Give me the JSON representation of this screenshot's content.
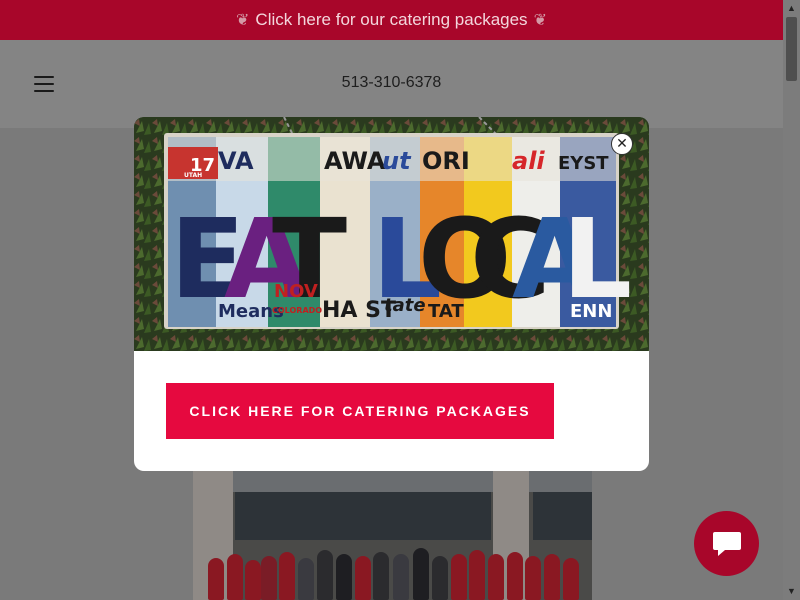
{
  "announcement": {
    "text": "Click here for our catering packages",
    "leaf_icon": "leaf-icon"
  },
  "header": {
    "phone": "513-310-6378",
    "menu_icon": "hamburger-menu-icon"
  },
  "modal": {
    "image": {
      "alt_semantic": "eat-local-license-plate-sign",
      "sign_letters": [
        "E",
        "A",
        "T",
        "L",
        "O",
        "C",
        "A",
        "L"
      ],
      "plate_fragments_top": [
        "VA",
        "AWA",
        "ut",
        "ORI",
        "ali",
        "EYST"
      ],
      "plate_fragments_bottom": [
        "Means",
        "NOV",
        "COLORADO",
        "HA ST",
        "tate",
        "TAT",
        "ENN"
      ],
      "plate_number_fragment": "17",
      "plate_state_fragment": "UTAH"
    },
    "cta_label": "CLICK HERE FOR CATERING PACKAGES",
    "close_icon": "close-icon"
  },
  "chat": {
    "icon": "chat-bubble-icon"
  },
  "colors": {
    "brand": "#a8062a",
    "cta": "#e6093f",
    "modal_bg": "#ffffff"
  }
}
